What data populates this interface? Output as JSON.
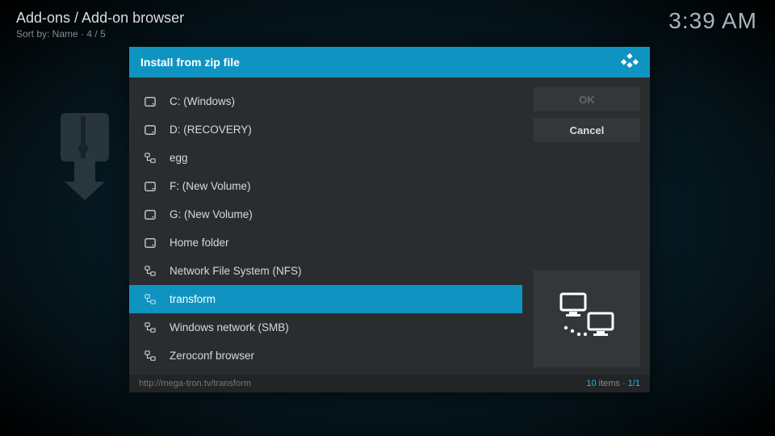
{
  "header": {
    "breadcrumb": "Add-ons / Add-on browser",
    "sort_label": "Sort by: Name",
    "page_index": "4 / 5"
  },
  "clock": "3:39 AM",
  "dialog": {
    "title": "Install from zip file",
    "items": [
      {
        "icon": "drive",
        "label": "C: (Windows)"
      },
      {
        "icon": "drive",
        "label": "D: (RECOVERY)"
      },
      {
        "icon": "network",
        "label": "egg"
      },
      {
        "icon": "drive",
        "label": "F: (New Volume)"
      },
      {
        "icon": "drive",
        "label": "G: (New Volume)"
      },
      {
        "icon": "drive",
        "label": "Home folder"
      },
      {
        "icon": "network",
        "label": "Network File System (NFS)"
      },
      {
        "icon": "network",
        "label": "transform"
      },
      {
        "icon": "network",
        "label": "Windows network (SMB)"
      },
      {
        "icon": "network",
        "label": "Zeroconf browser"
      }
    ],
    "selected_index": 7,
    "buttons": {
      "ok": "OK",
      "cancel": "Cancel"
    },
    "footer": {
      "path": "http://mega-tron.tv/transform",
      "count_num": "10",
      "count_label": " items · ",
      "page": "1/1"
    }
  }
}
